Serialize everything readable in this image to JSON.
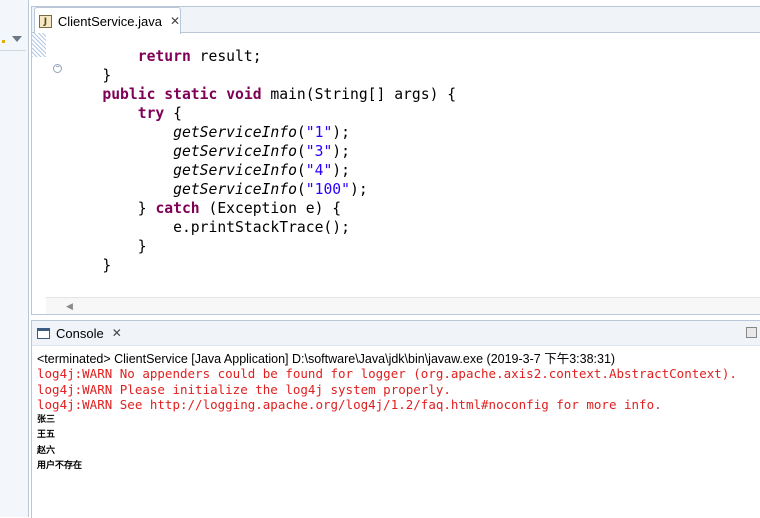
{
  "editor": {
    "tab_title": "ClientService.java",
    "file_icon_label": "J",
    "lines": [
      {
        "segments": [
          {
            "t": "        "
          },
          {
            "t": "return",
            "c": "kw"
          },
          {
            "t": " result;"
          }
        ]
      },
      {
        "segments": [
          {
            "t": "    }"
          }
        ]
      },
      {
        "segments": [
          {
            "t": "    "
          },
          {
            "t": "public",
            "c": "kw"
          },
          {
            "t": " "
          },
          {
            "t": "static",
            "c": "kw"
          },
          {
            "t": " "
          },
          {
            "t": "void",
            "c": "kw"
          },
          {
            "t": " main(String[] args) {"
          }
        ]
      },
      {
        "segments": [
          {
            "t": "        "
          },
          {
            "t": "try",
            "c": "kw"
          },
          {
            "t": " {"
          }
        ]
      },
      {
        "segments": [
          {
            "t": "            "
          },
          {
            "t": "getServiceInfo",
            "c": "it"
          },
          {
            "t": "("
          },
          {
            "t": "\"1\"",
            "c": "str"
          },
          {
            "t": ");"
          }
        ]
      },
      {
        "segments": [
          {
            "t": "            "
          },
          {
            "t": "getServiceInfo",
            "c": "it"
          },
          {
            "t": "("
          },
          {
            "t": "\"3\"",
            "c": "str"
          },
          {
            "t": ");"
          }
        ]
      },
      {
        "segments": [
          {
            "t": "            "
          },
          {
            "t": "getServiceInfo",
            "c": "it"
          },
          {
            "t": "("
          },
          {
            "t": "\"4\"",
            "c": "str"
          },
          {
            "t": ");"
          }
        ]
      },
      {
        "segments": [
          {
            "t": "            "
          },
          {
            "t": "getServiceInfo",
            "c": "it"
          },
          {
            "t": "("
          },
          {
            "t": "\"100\"",
            "c": "str"
          },
          {
            "t": ");"
          }
        ]
      },
      {
        "segments": [
          {
            "t": "        } "
          },
          {
            "t": "catch",
            "c": "kw"
          },
          {
            "t": " (Exception e) {"
          }
        ]
      },
      {
        "segments": [
          {
            "t": "            e.printStackTrace();"
          }
        ]
      },
      {
        "segments": [
          {
            "t": "        }"
          }
        ]
      },
      {
        "segments": [
          {
            "t": "    }"
          }
        ]
      },
      {
        "segments": [
          {
            "t": ""
          }
        ]
      },
      {
        "segments": [
          {
            "t": "}"
          }
        ]
      }
    ]
  },
  "console": {
    "tab_title": "Console",
    "status": "<terminated> ClientService [Java Application] D:\\software\\Java\\jdk\\bin\\javaw.exe (2019-3-7 下午3:38:31)",
    "warnings": [
      "log4j:WARN No appenders could be found for logger (org.apache.axis2.context.AbstractContext).",
      "log4j:WARN Please initialize the log4j system properly.",
      "log4j:WARN See http://logging.apache.org/log4j/1.2/faq.html#noconfig for more info."
    ],
    "output": [
      "张三",
      "王五",
      "赵六",
      "用户不存在"
    ]
  },
  "icons": {
    "close": "✕",
    "fold_collapse": "−",
    "scroll_left": "◀"
  }
}
